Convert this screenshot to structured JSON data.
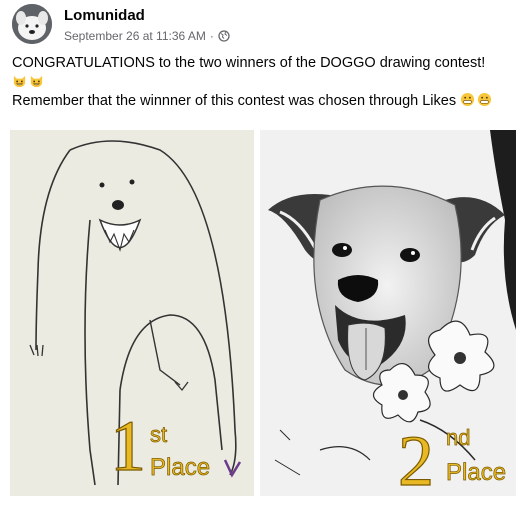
{
  "post": {
    "author": "Lomunidad",
    "timestamp": "September 26 at 11:36 AM",
    "separator": "·",
    "privacy_icon": "globe-icon",
    "line1": "CONGRATULATIONS to the two winners of the DOGGO drawing contest!",
    "line3": "Remember that the winnner of this contest was chosen through Likes",
    "emoji_line2": [
      "cat-grin-emoji",
      "cat-grin-emoji"
    ],
    "emoji_line3": [
      "grimace-emoji",
      "grimace-emoji"
    ]
  },
  "photos": [
    {
      "name": "winner-drawing-1",
      "number": "1",
      "suffix": "st",
      "word": "Place",
      "description_icon": "doodle-dog"
    },
    {
      "name": "winner-drawing-2",
      "number": "2",
      "suffix": "nd",
      "word": "Place",
      "description_icon": "ink-dog-sketch"
    }
  ],
  "colors": {
    "label_gold": "#e8b923",
    "meta_gray": "#65676b",
    "text": "#050505"
  }
}
